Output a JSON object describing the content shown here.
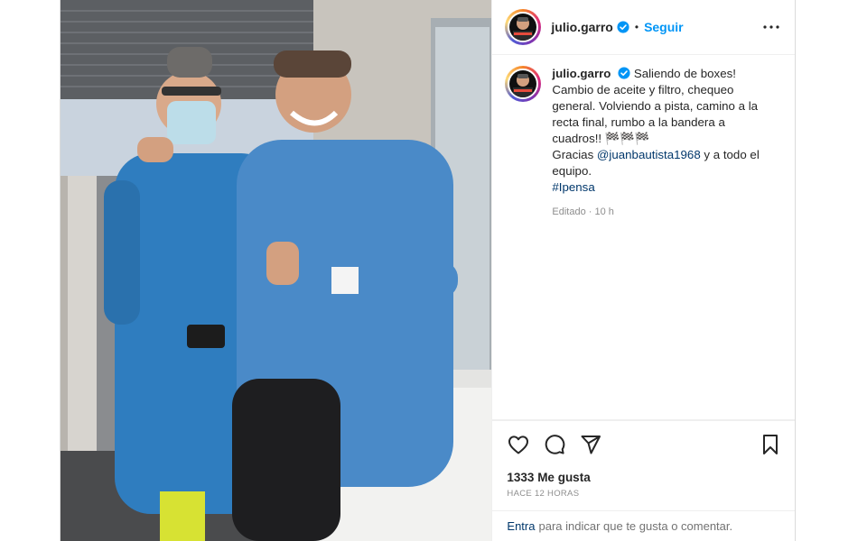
{
  "header": {
    "username": "julio.garro",
    "separator": "•",
    "follow_label": "Seguir"
  },
  "caption": {
    "username": "julio.garro",
    "text_1": "Saliendo de boxes! Cambio de aceite y filtro, chequeo general. Volviendo a pista, camino a la recta final, rumbo a la bandera a cuadros!! 🏁🏁🏁",
    "text_2": "Gracias ",
    "mention": "@juanbautista1968",
    "text_3": " y a todo el equipo.",
    "hashtag": "#Ipensa",
    "edited": "Editado · 10 h"
  },
  "likes": "1333 Me gusta",
  "time": "HACE 12 HORAS",
  "comment": {
    "enter_label": "Entra",
    "rest": "para indicar que te gusta o comentar."
  },
  "icons": {
    "verified": "verified-badge-icon",
    "more": "more-options-icon",
    "like": "heart-icon",
    "comment": "comment-icon",
    "share": "share-icon",
    "save": "bookmark-icon"
  },
  "colors": {
    "follow": "#0095f6",
    "link": "#00376b",
    "verified": "#0095f6",
    "gown": "#3b87c8"
  }
}
